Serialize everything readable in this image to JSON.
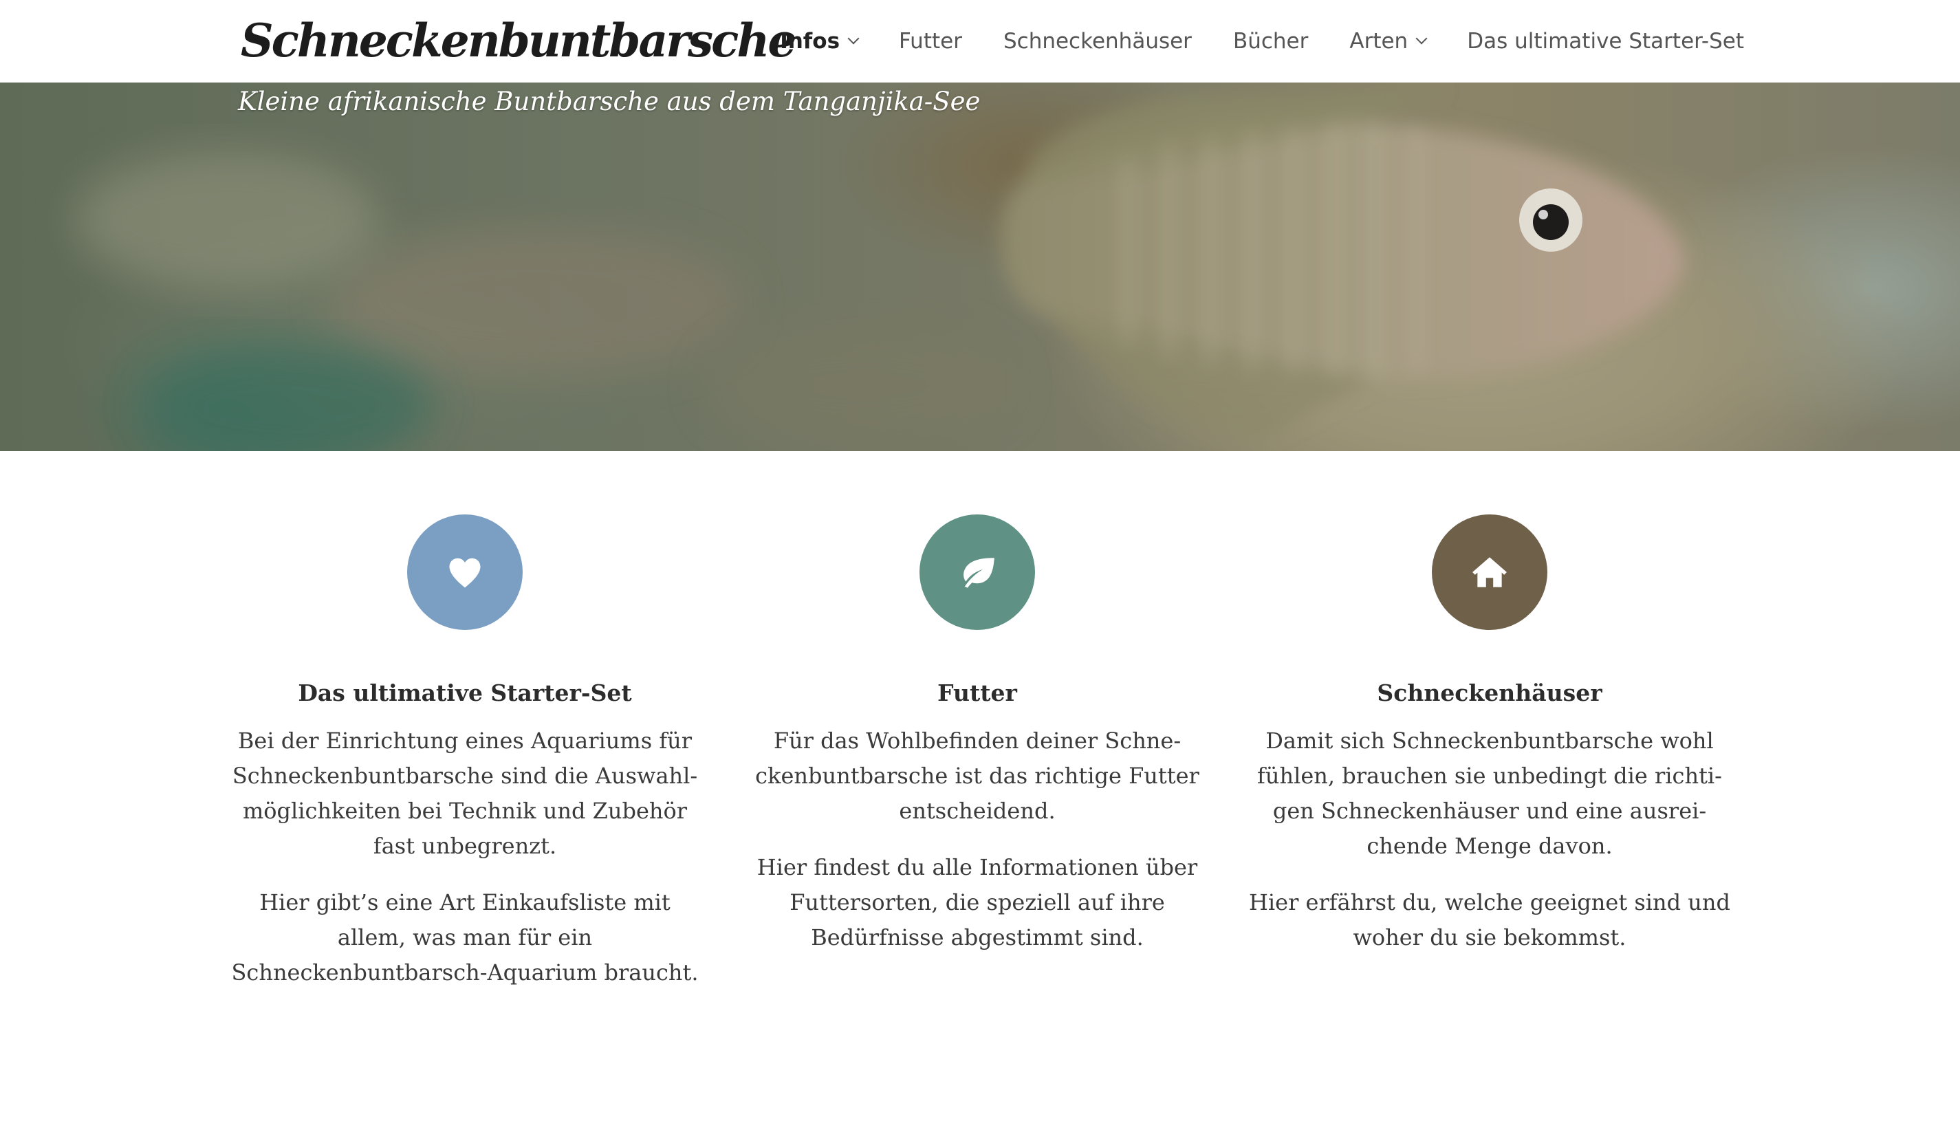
{
  "header": {
    "logo": "Schneckenbuntbarsche",
    "nav": [
      {
        "label": "Infos",
        "has_dropdown": true,
        "active": true
      },
      {
        "label": "Futter",
        "has_dropdown": false,
        "active": false
      },
      {
        "label": "Schneckenhäuser",
        "has_dropdown": false,
        "active": false
      },
      {
        "label": "Bücher",
        "has_dropdown": false,
        "active": false
      },
      {
        "label": "Arten",
        "has_dropdown": true,
        "active": false
      },
      {
        "label": "Das ultimative Starter-Set",
        "has_dropdown": false,
        "active": false
      }
    ]
  },
  "hero": {
    "tagline": "Kleine afrikanische Buntbarsche aus dem Tanganjika-See"
  },
  "features": [
    {
      "icon": "heart-icon",
      "color": "#7a9fc2",
      "title": "Das ultimative Starter-Set",
      "paragraphs": [
        "Bei der Einrichtung eines Aquariums für Schneckenbuntbarsche sind die Auswahl­möglichkeiten bei Technik und Zubehör fast unbegrenzt.",
        "Hier gibt’s eine Art Einkaufsliste mit allem, was man für ein Schneckenbuntbarsch-Aquarium braucht."
      ]
    },
    {
      "icon": "leaf-icon",
      "color": "#5f9184",
      "title": "Futter",
      "paragraphs": [
        "Für das Wohlbefinden deiner Schne­ckenbuntbarsche ist das richtige Futter entscheidend.",
        "Hier findest du alle Informationen über Futtersorten, die speziell auf ihre Bedürfnisse abgestimmt sind."
      ]
    },
    {
      "icon": "house-icon",
      "color": "#6e6049",
      "title": "Schneckenhäuser",
      "paragraphs": [
        "Damit sich Schneckenbuntbarsche wohl fühlen, brauchen sie unbedingt die richti­gen Schneckenhäuser und eine ausrei­chende Menge davon.",
        "Hier erfährst du, welche geeignet sind und woher du sie bekommst."
      ]
    }
  ]
}
